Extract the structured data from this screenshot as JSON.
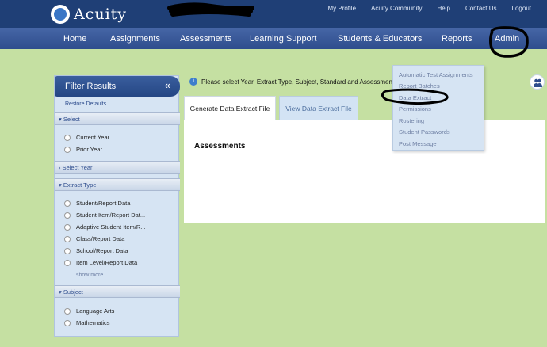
{
  "header": {
    "logo_text": "Acuity",
    "util_links": [
      "My Profile",
      "Acuity Community",
      "Help",
      "Contact Us",
      "Logout"
    ]
  },
  "nav": {
    "items": [
      "Home",
      "Assignments",
      "Assessments",
      "Learning Support",
      "Students & Educators",
      "Reports",
      "Admin"
    ]
  },
  "filter": {
    "title": "Filter Results",
    "restore": "Restore Defaults",
    "sections": {
      "select": "Select",
      "select_year": "Select Year",
      "extract_type": "Extract Type",
      "subject": "Subject"
    },
    "select_options": [
      "Current Year",
      "Prior Year"
    ],
    "extract_options": [
      "Student/Report Data",
      "Student Item/Report Dat...",
      "Adaptive Student Item/R...",
      "Class/Report Data",
      "School/Report Data",
      "Item Level/Report Data"
    ],
    "show_more": "show more",
    "subject_options": [
      "Language Arts",
      "Mathematics"
    ]
  },
  "info": {
    "text": "Please select Year, Extract Type, Subject, Standard and Assessment"
  },
  "tabs": [
    "Generate Data Extract File",
    "View Data Extract File"
  ],
  "content": {
    "title": "Assessments"
  },
  "admin_menu": {
    "items": [
      "Automatic Test Assignments",
      "Report Batches",
      "Data Extract",
      "Permissions",
      "Rostering",
      "Student Passwords",
      "Post Message"
    ]
  },
  "colors": {
    "header_bg": "#1f3f76",
    "nav_bg": "#2e4d8d",
    "page_bg": "#c5e0a2",
    "panel_bg": "#d6e4f3"
  }
}
